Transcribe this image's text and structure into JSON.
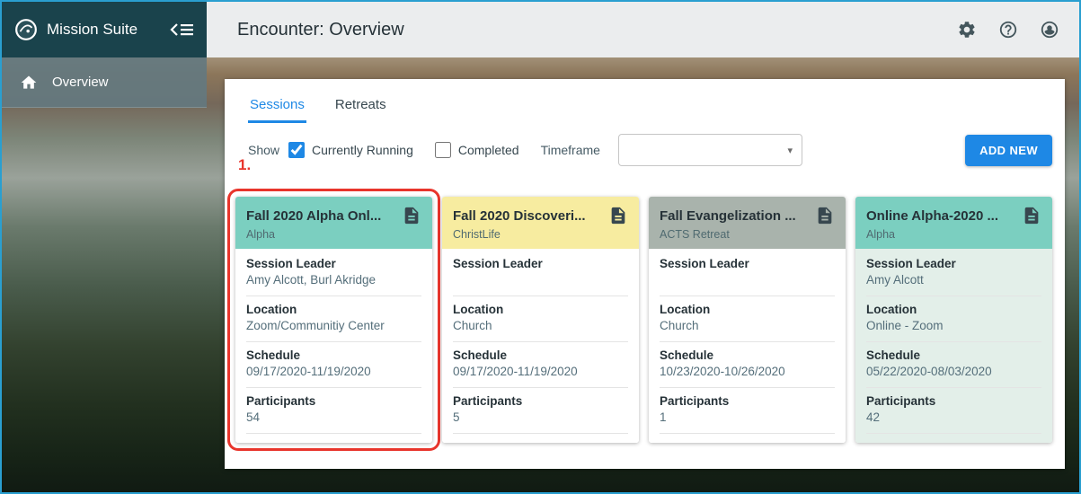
{
  "colors": {
    "accent_blue": "#1e88e5",
    "annotation_red": "#e8352c",
    "sidebar_dark": "#1a434c",
    "window_border": "#2a9fd0"
  },
  "sidebar": {
    "brand": "Mission Suite",
    "items": [
      {
        "label": "Overview",
        "icon": "home"
      }
    ]
  },
  "header": {
    "title": "Encounter: Overview",
    "icons": [
      "settings",
      "help",
      "account"
    ]
  },
  "main": {
    "tabs": [
      {
        "label": "Sessions",
        "active": true
      },
      {
        "label": "Retreats",
        "active": false
      }
    ],
    "filters": {
      "show_label": "Show",
      "options": [
        {
          "label": "Currently Running",
          "checked": true
        },
        {
          "label": "Completed",
          "checked": false
        }
      ],
      "timeframe_label": "Timeframe",
      "timeframe_value": "",
      "add_new_label": "ADD NEW"
    },
    "annotation": {
      "label": "1."
    },
    "cards": [
      {
        "title": "Fall 2020 Alpha Onl...",
        "subtitle": "Alpha",
        "header_color": "#7bcfc0",
        "body_color": "#ffffff",
        "highlighted": true,
        "fields": [
          {
            "label": "Session Leader",
            "value": "Amy Alcott, Burl Akridge"
          },
          {
            "label": "Location",
            "value": "Zoom/Communitiy Center"
          },
          {
            "label": "Schedule",
            "value": "09/17/2020-11/19/2020"
          },
          {
            "label": "Participants",
            "value": "54"
          }
        ]
      },
      {
        "title": "Fall 2020 Discoveri...",
        "subtitle": "ChristLife",
        "header_color": "#f7eca0",
        "body_color": "#ffffff",
        "highlighted": false,
        "fields": [
          {
            "label": "Session Leader",
            "value": ""
          },
          {
            "label": "Location",
            "value": "Church"
          },
          {
            "label": "Schedule",
            "value": "09/17/2020-11/19/2020"
          },
          {
            "label": "Participants",
            "value": "5"
          }
        ]
      },
      {
        "title": "Fall Evangelization ...",
        "subtitle": "ACTS Retreat",
        "header_color": "#a9b3ac",
        "body_color": "#ffffff",
        "highlighted": false,
        "fields": [
          {
            "label": "Session Leader",
            "value": ""
          },
          {
            "label": "Location",
            "value": "Church"
          },
          {
            "label": "Schedule",
            "value": "10/23/2020-10/26/2020"
          },
          {
            "label": "Participants",
            "value": "1"
          }
        ]
      },
      {
        "title": "Online Alpha-2020 ...",
        "subtitle": "Alpha",
        "header_color": "#7bcfc0",
        "body_color": "#e3efe9",
        "highlighted": false,
        "fields": [
          {
            "label": "Session Leader",
            "value": "Amy Alcott"
          },
          {
            "label": "Location",
            "value": "Online - Zoom"
          },
          {
            "label": "Schedule",
            "value": "05/22/2020-08/03/2020"
          },
          {
            "label": "Participants",
            "value": "42"
          }
        ]
      }
    ]
  }
}
